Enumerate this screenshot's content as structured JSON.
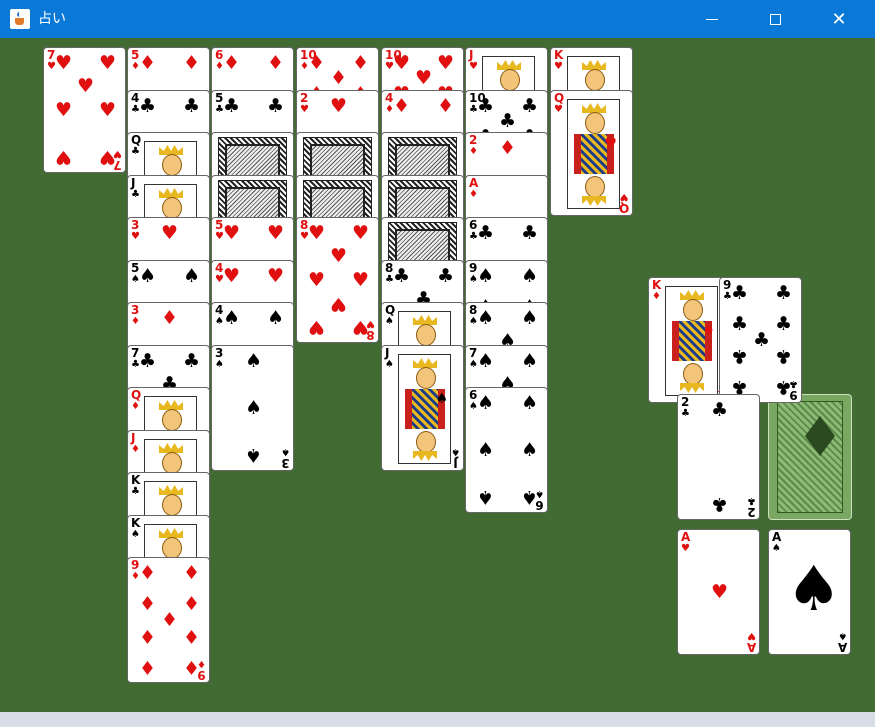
{
  "window": {
    "title": "占い",
    "minimize_label": "—",
    "maximize_label": "☐",
    "close_label": "✕",
    "app_icon": "java-cup-icon"
  },
  "colors": {
    "felt": "#426a33",
    "titlebar": "#0a78d7",
    "red_suit": "#e01010",
    "stock_back": "#7aa862"
  },
  "glyphs": {
    "H": "♥",
    "D": "♦",
    "C": "♣",
    "S": "♠"
  },
  "tableau": [
    {
      "name": "column-1",
      "cards": [
        {
          "rank": "7",
          "suit": "H",
          "face_up": true
        }
      ]
    },
    {
      "name": "column-2",
      "cards": [
        {
          "rank": "5",
          "suit": "D",
          "face_up": true
        },
        {
          "rank": "4",
          "suit": "C",
          "face_up": true
        },
        {
          "rank": "Q",
          "suit": "C",
          "face_up": true
        },
        {
          "rank": "J",
          "suit": "C",
          "face_up": true
        },
        {
          "rank": "3",
          "suit": "H",
          "face_up": true
        },
        {
          "rank": "5",
          "suit": "S",
          "face_up": true
        },
        {
          "rank": "3",
          "suit": "D",
          "face_up": true
        },
        {
          "rank": "7",
          "suit": "C",
          "face_up": true
        },
        {
          "rank": "Q",
          "suit": "D",
          "face_up": true
        },
        {
          "rank": "J",
          "suit": "D",
          "face_up": true
        },
        {
          "rank": "K",
          "suit": "C",
          "face_up": true
        },
        {
          "rank": "K",
          "suit": "S",
          "face_up": true
        },
        {
          "rank": "9",
          "suit": "D",
          "face_up": true
        }
      ]
    },
    {
      "name": "column-3",
      "cards": [
        {
          "rank": "6",
          "suit": "D",
          "face_up": true
        },
        {
          "rank": "5",
          "suit": "C",
          "face_up": true
        },
        {
          "face_up": false
        },
        {
          "face_up": false
        },
        {
          "rank": "5",
          "suit": "H",
          "face_up": true
        },
        {
          "rank": "4",
          "suit": "H",
          "face_up": true
        },
        {
          "rank": "4",
          "suit": "S",
          "face_up": true
        },
        {
          "rank": "3",
          "suit": "S",
          "face_up": true
        }
      ]
    },
    {
      "name": "column-4",
      "cards": [
        {
          "rank": "10",
          "suit": "D",
          "face_up": true
        },
        {
          "rank": "2",
          "suit": "H",
          "face_up": true
        },
        {
          "face_up": false
        },
        {
          "face_up": false
        },
        {
          "rank": "8",
          "suit": "H",
          "face_up": true
        }
      ]
    },
    {
      "name": "column-5",
      "cards": [
        {
          "rank": "10",
          "suit": "H",
          "face_up": true
        },
        {
          "rank": "4",
          "suit": "D",
          "face_up": true
        },
        {
          "face_up": false
        },
        {
          "face_up": false
        },
        {
          "face_up": false
        },
        {
          "rank": "8",
          "suit": "C",
          "face_up": true
        },
        {
          "rank": "Q",
          "suit": "S",
          "face_up": true
        },
        {
          "rank": "J",
          "suit": "S",
          "face_up": true
        }
      ]
    },
    {
      "name": "column-6",
      "cards": [
        {
          "rank": "J",
          "suit": "H",
          "face_up": true
        },
        {
          "rank": "10",
          "suit": "C",
          "face_up": true
        },
        {
          "rank": "2",
          "suit": "D",
          "face_up": true
        },
        {
          "rank": "A",
          "suit": "D",
          "face_up": true
        },
        {
          "rank": "6",
          "suit": "C",
          "face_up": true
        },
        {
          "rank": "9",
          "suit": "S",
          "face_up": true
        },
        {
          "rank": "8",
          "suit": "S",
          "face_up": true
        },
        {
          "rank": "7",
          "suit": "S",
          "face_up": true
        },
        {
          "rank": "6",
          "suit": "S",
          "face_up": true
        }
      ]
    },
    {
      "name": "column-7",
      "cards": [
        {
          "rank": "K",
          "suit": "H",
          "face_up": true
        },
        {
          "rank": "Q",
          "suit": "H",
          "face_up": true
        }
      ]
    }
  ],
  "side_cards": [
    {
      "name": "reserve-king-diamonds",
      "rank": "K",
      "suit": "D",
      "face_up": true
    },
    {
      "name": "reserve-nine-clubs",
      "rank": "9",
      "suit": "C",
      "face_up": true
    },
    {
      "name": "waste-two-clubs",
      "rank": "2",
      "suit": "C",
      "face_up": true
    },
    {
      "name": "foundation-ace-hearts",
      "rank": "A",
      "suit": "H",
      "face_up": true
    },
    {
      "name": "foundation-ace-spades",
      "rank": "A",
      "suit": "S",
      "face_up": true
    }
  ],
  "stock": {
    "name": "stock-pile",
    "face_up": false,
    "emblem": "diamond-icon"
  }
}
